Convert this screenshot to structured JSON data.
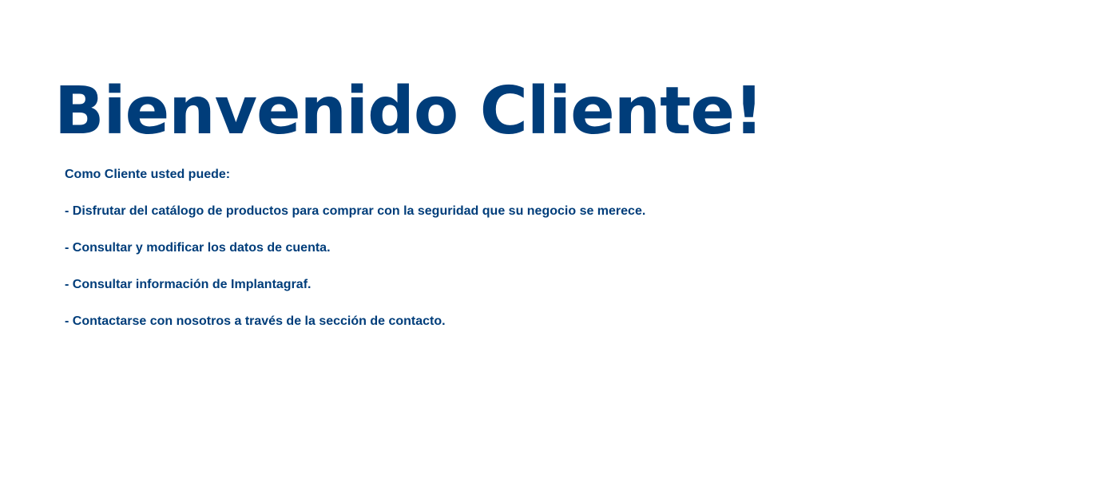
{
  "colors": {
    "text": "#003d7a",
    "background": "#ffffff"
  },
  "welcome": {
    "title": "Bienvenido Cliente!",
    "intro": "Como Cliente usted puede:",
    "features": [
      "- Disfrutar del catálogo de productos para comprar con la seguridad que su negocio se merece.",
      "- Consultar y modificar los datos de cuenta.",
      "- Consultar información de Implantagraf.",
      "- Contactarse con nosotros a través de la sección de contacto."
    ]
  }
}
